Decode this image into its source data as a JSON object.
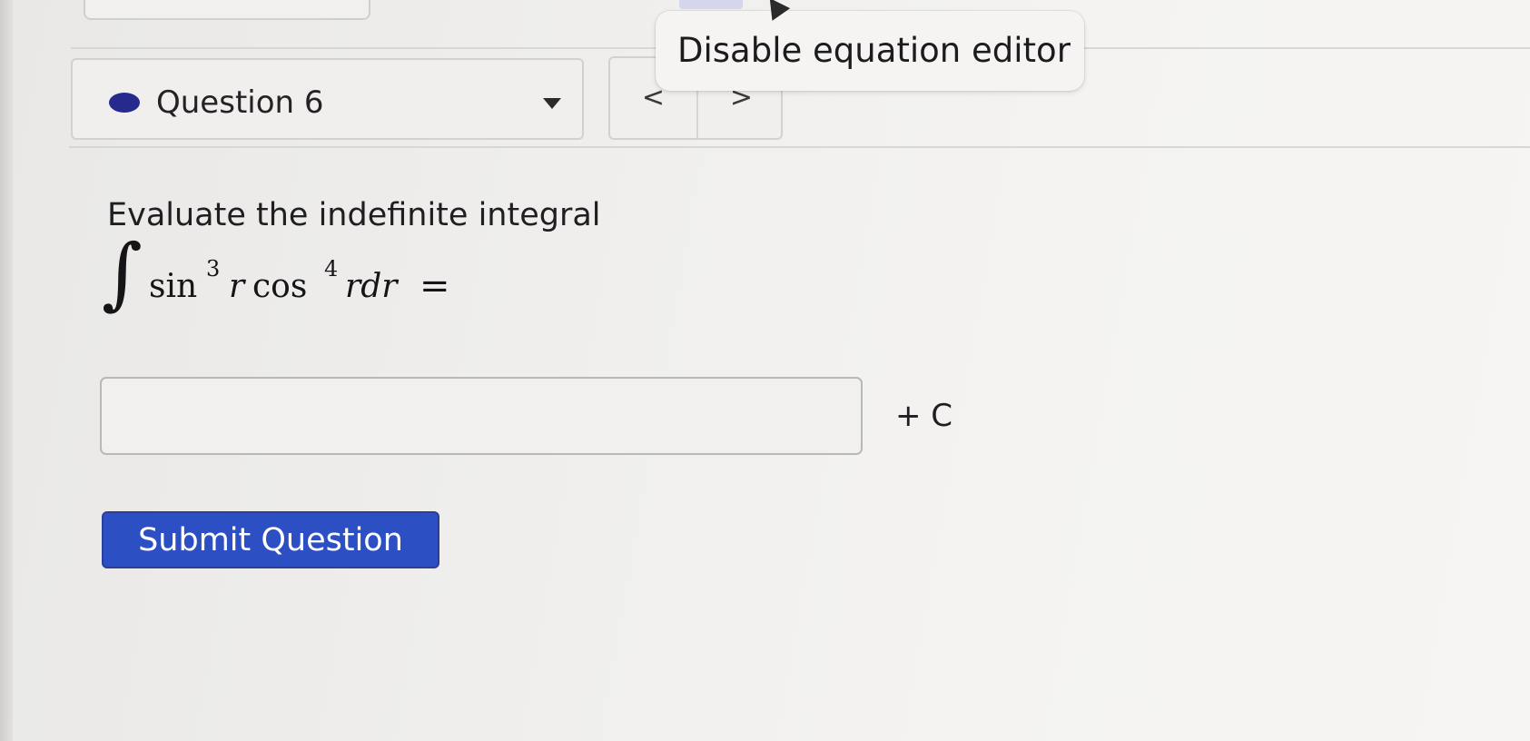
{
  "question_nav": {
    "current_label": "Question 6",
    "status_color": "#262a8c",
    "dropdown_icon": "caret-down-icon",
    "prev_label": "<",
    "next_label": ">"
  },
  "tooltip": {
    "text": "Disable equation editor"
  },
  "problem": {
    "prompt": "Evaluate the indefinite integral",
    "integral_symbol": "∫",
    "sin": "sin",
    "sin_exponent": "3",
    "var_r": "r",
    "cos": "cos",
    "cos_exponent": "4",
    "differential": "rdr",
    "equals": "="
  },
  "answer": {
    "value": "",
    "placeholder": "",
    "suffix": "+ C"
  },
  "submit": {
    "label": "Submit Question",
    "color": "#2d4fc4"
  }
}
